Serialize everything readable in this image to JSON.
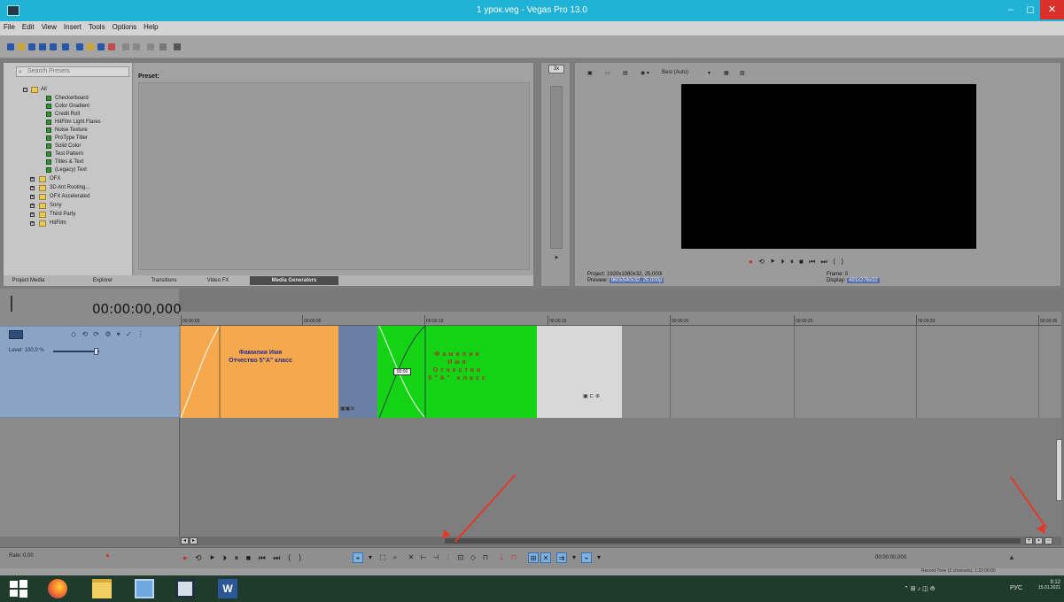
{
  "window": {
    "title": "1 урок.veg - Vegas Pro 13.0",
    "controls": [
      "–",
      "◻",
      "✕"
    ]
  },
  "menu": [
    "File",
    "Edit",
    "View",
    "Insert",
    "Tools",
    "Options",
    "Help"
  ],
  "explorer": {
    "search_placeholder": "Search Presets",
    "tree": [
      {
        "label": "All",
        "type": "folder",
        "expanded": true
      },
      {
        "label": "Checkerboard",
        "type": "generator"
      },
      {
        "label": "Color Gradient",
        "type": "generator"
      },
      {
        "label": "Credit Roll",
        "type": "generator"
      },
      {
        "label": "HitFilm Light Flares",
        "type": "generator"
      },
      {
        "label": "Noise Texture",
        "type": "generator"
      },
      {
        "label": "ProType Titler",
        "type": "generator"
      },
      {
        "label": "Solid Color",
        "type": "generator"
      },
      {
        "label": "Test Pattern",
        "type": "generator"
      },
      {
        "label": "Titles & Text",
        "type": "generator"
      },
      {
        "label": "(Legacy) Text",
        "type": "generator"
      },
      {
        "label": "OFX",
        "type": "folder"
      },
      {
        "label": "3D Ant Rooting...",
        "type": "folder"
      },
      {
        "label": "OFX Accelerated",
        "type": "folder"
      },
      {
        "label": "Sony",
        "type": "folder"
      },
      {
        "label": "Third Party",
        "type": "folder"
      },
      {
        "label": "HitFilm",
        "type": "folder"
      }
    ],
    "preset_label": "Preset:",
    "tabs": [
      "Project Media",
      "Explorer",
      "Transitions",
      "Video FX",
      "Media Generators"
    ],
    "active_tab": "Media Generators"
  },
  "trimmer": {
    "dropdown": "3x"
  },
  "preview": {
    "quality": "Best (Auto)",
    "project_label": "Project:",
    "project_value": "1920x1080x32, 25,000i",
    "preview_label": "Preview:",
    "preview_value": "960x540x32, 25,000p",
    "frame_label": "Frame:",
    "frame_value": "0",
    "display_label": "Display:",
    "display_value": "491x276x32"
  },
  "timeline": {
    "timecode": "00:00:00,000",
    "track_level": "Level: 100,0 %",
    "ruler_ticks": [
      "00:00:00",
      "00:00:05",
      "00:00:10",
      "00:00:15",
      "00:00:20",
      "00:00:25",
      "00:00:30",
      "00:00:35"
    ],
    "clip1_text": "Фамилия Имя Отчество 5\"А\" класс",
    "clip3_text": "Фамилия Имя Отчество 5\"А\" класс",
    "crossfade_label": "00:00"
  },
  "bottom": {
    "rate_label": "Rate: 0,00",
    "time_readout": "00:00:00,000",
    "status": "Record Time (2 channels): 1:22:00:00"
  },
  "taskbar": {
    "lang": "РУС",
    "clock_time": "9:12",
    "clock_date": "15.01.2021"
  },
  "colors": {
    "titlebar": "#1fb2d6",
    "clip_orange": "#f5a94c",
    "clip_green": "#14d214",
    "clip_blue": "#6a7fa3",
    "track_header": "#8ba3c5",
    "annotation_arrow": "#e13a2a"
  }
}
